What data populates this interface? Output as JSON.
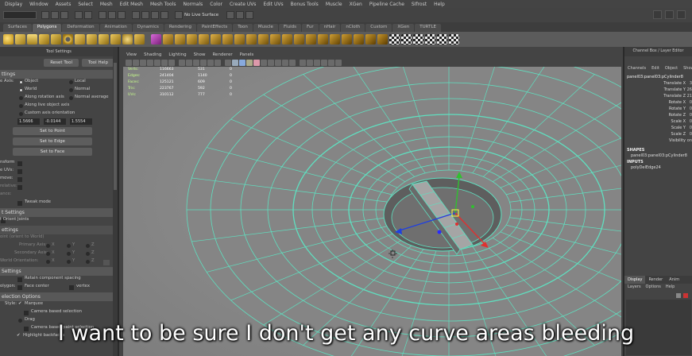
{
  "menubar": [
    "Display",
    "Window",
    "Assets",
    "Select",
    "Mesh",
    "Edit Mesh",
    "Mesh Tools",
    "Normals",
    "Color",
    "Create UVs",
    "Edit UVs",
    "Bonus Tools",
    "Muscle",
    "XGen",
    "Pipeline Cache",
    "SIfrost",
    "Help"
  ],
  "statusline": {
    "live_surface": "No Live Surface"
  },
  "shelf_tabs": [
    "Surfaces",
    "Polygons",
    "Deformation",
    "Animation",
    "Dynamics",
    "Rendering",
    "PaintEffects",
    "Toon",
    "Muscle",
    "Fluids",
    "Fur",
    "nHair",
    "nCloth",
    "Custom",
    "XGen",
    "TURTLE"
  ],
  "shelf_active_tab": "Polygons",
  "tool_settings": {
    "title": "Tool Settings",
    "reset_tool": "Reset Tool",
    "tool_help": "Tool Help",
    "section_settings": "ttings",
    "move_axis_label": "e Axis:",
    "opt_object": "Object",
    "opt_local": "Local",
    "opt_world": "World",
    "opt_normal": "Normal",
    "opt_along_rotation": "Along rotation axis",
    "opt_normal_average": "Normal average",
    "opt_along_live": "Along live object axis",
    "opt_custom_axis": "Custom axis orientation",
    "custom_values": [
      "1.5666",
      "-0.0144",
      "1.5554"
    ],
    "set_to_point": "Set to Point",
    "set_to_edge": "Set to Edge",
    "set_to_face": "Set to Face",
    "label_transform": "nsform",
    "label_uvs": "e UVs:",
    "label_move": "move:",
    "label_relative": "relative:",
    "label_ance": "ance:",
    "tweak_mode": "Tweak mode",
    "section_joint": "t Settings",
    "orient_joints": "t Orient Joints",
    "section_joint2": "ettings",
    "joint_world": "oint (orient to World)",
    "primary_axis": "Primary Axis:",
    "secondary_axis": "Secondary Axis:",
    "world_orientation": "World Orientation:",
    "axis_x": "X",
    "axis_y": "Y",
    "axis_z": "Z",
    "axis_none": "None",
    "section_settings2": "Settings",
    "retain_spacing": "Retain component spacing",
    "polygon_label": "olygon:",
    "face_center": "Face center",
    "vertex": "vertex",
    "section_selection": "election Options",
    "style_label": "Style:",
    "marquee": "Marquee",
    "camera_based": "Camera based selection",
    "drag": "Drag",
    "camera_paint": "Camera based paint selection",
    "highlight_backfaces": "Highlight backfaces"
  },
  "viewport": {
    "menu": [
      "View",
      "Shading",
      "Lighting",
      "Show",
      "Renderer",
      "Panels"
    ],
    "hud": [
      {
        "label": "Verts:",
        "a": "116663",
        "b": "531",
        "c": "0"
      },
      {
        "label": "Edges:",
        "a": "241404",
        "b": "1140",
        "c": "0"
      },
      {
        "label": "Faces:",
        "a": "125121",
        "b": "609",
        "c": "0"
      },
      {
        "label": "Tris:",
        "a": "223767",
        "b": "592",
        "c": "0"
      },
      {
        "label": "UVs:",
        "a": "310112",
        "b": "777",
        "c": "0"
      }
    ]
  },
  "channel_box": {
    "title": "Channel Box / Layer Editor",
    "menu": [
      "Channels",
      "Edit",
      "Object",
      "Show"
    ],
    "object_name": "panel03:panel03:pCylinder8",
    "attributes": [
      {
        "name": "Translate X",
        "value": "3"
      },
      {
        "name": "Translate Y",
        "value": "26"
      },
      {
        "name": "Translate Z",
        "value": "21"
      },
      {
        "name": "Rotate X",
        "value": "0"
      },
      {
        "name": "Rotate Y",
        "value": "0"
      },
      {
        "name": "Rotate Z",
        "value": "0"
      },
      {
        "name": "Scale X",
        "value": "0"
      },
      {
        "name": "Scale Y",
        "value": "0"
      },
      {
        "name": "Scale Z",
        "value": "0"
      },
      {
        "name": "Visibility",
        "value": "on"
      }
    ],
    "shapes_head": "SHAPES",
    "shape_name": "panel03:panel03:pCylinder8",
    "inputs_head": "INPUTS",
    "input_name": "polyDelEdge24",
    "layer_tabs": [
      "Display",
      "Render",
      "Anim"
    ],
    "layer_menu": [
      "Layers",
      "Options",
      "Help"
    ]
  },
  "subtitle": "I want to be sure I don't get any curve areas bleeding",
  "colors": {
    "wire": "#5fe0c0",
    "viewport_bg": "#8a8a8a",
    "hud_label": "#c8ff8a",
    "manip_x": "#e03030",
    "manip_y": "#30c030",
    "manip_z": "#2040e0"
  }
}
